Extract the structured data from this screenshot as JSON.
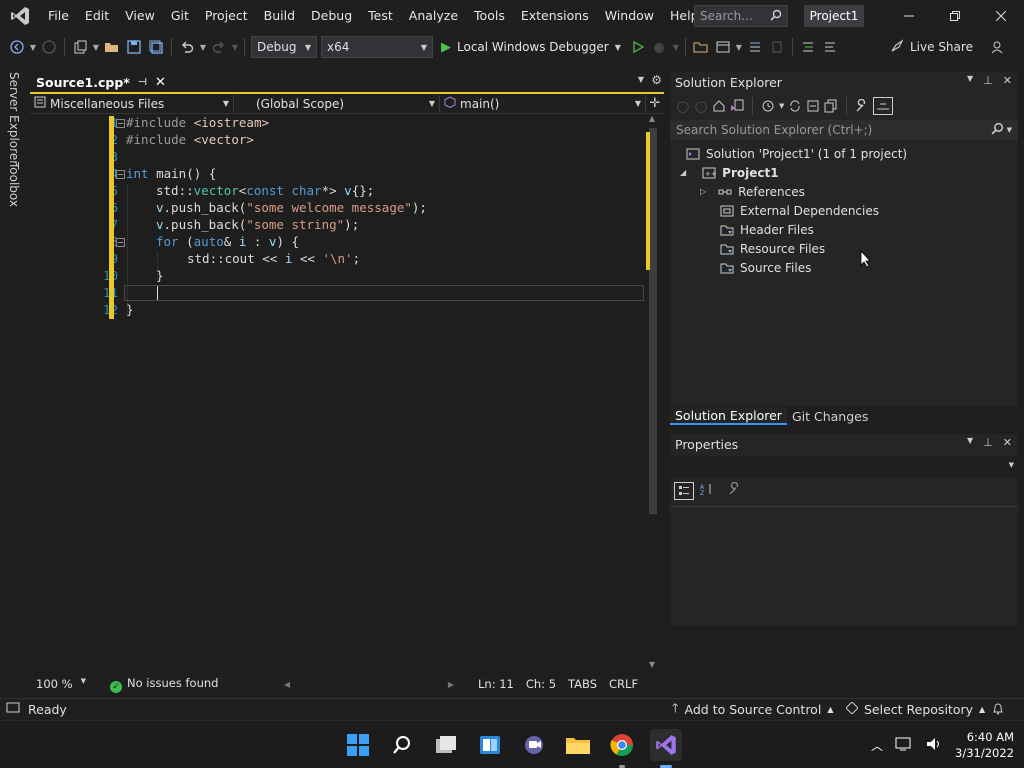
{
  "menubar": {
    "items": [
      "File",
      "Edit",
      "View",
      "Git",
      "Project",
      "Build",
      "Debug",
      "Test",
      "Analyze",
      "Tools",
      "Extensions",
      "Window",
      "Help"
    ],
    "search_placeholder": "Search...",
    "project_name": "Project1"
  },
  "toolbar": {
    "configuration": "Debug",
    "platform": "x64",
    "run_label": "Local Windows Debugger",
    "live_share": "Live Share"
  },
  "left_strip": {
    "server_explorer": "Server Explorer",
    "toolbox": "Toolbox"
  },
  "editor": {
    "tab_title": "Source1.cpp*",
    "nav_project": "Miscellaneous Files",
    "nav_scope": "(Global Scope)",
    "nav_member": "main()",
    "line_numbers": [
      "1",
      "2",
      "3",
      "4",
      "5",
      "6",
      "7",
      "8",
      "9",
      "10",
      "11",
      "12"
    ],
    "code": {
      "l1_pp": "#include",
      "l1_inc": "<iostream>",
      "l2_pp": "#include",
      "l2_inc": "<vector>",
      "l4_kw": "int",
      "l4_rest": " main() {",
      "l5_a": "std::",
      "l5_ty": "vector",
      "l5_b": "<",
      "l5_kw": "const char",
      "l5_c": "*> ",
      "l5_var": "v",
      "l5_d": "{};",
      "l6_var": "v",
      "l6_a": ".push_back(",
      "l6_str": "\"some welcome message\"",
      "l6_b": ");",
      "l7_var": "v",
      "l7_a": ".push_back(",
      "l7_str": "\"some string\"",
      "l7_b": ");",
      "l8_kw": "for",
      "l8_a": " (",
      "l8_kw2": "auto",
      "l8_b": "& ",
      "l8_var": "i",
      "l8_c": " : ",
      "l8_var2": "v",
      "l8_d": ") {",
      "l9_a": "std::cout << ",
      "l9_var": "i",
      "l9_b": " << ",
      "l9_str": "'\\n'",
      "l9_c": ";",
      "l10": "}",
      "l12": "}"
    },
    "status": {
      "zoom": "100 %",
      "issues": "No issues found",
      "line": "Ln: 11",
      "col": "Ch: 5",
      "tabs": "TABS",
      "eol": "CRLF"
    }
  },
  "solution_explorer": {
    "title": "Solution Explorer",
    "search_placeholder": "Search Solution Explorer (Ctrl+;)",
    "solution": "Solution 'Project1' (1 of 1 project)",
    "project": "Project1",
    "items": [
      "References",
      "External Dependencies",
      "Header Files",
      "Resource Files",
      "Source Files"
    ],
    "tabs": [
      "Solution Explorer",
      "Git Changes"
    ]
  },
  "properties": {
    "title": "Properties"
  },
  "statusbar": {
    "ready": "Ready",
    "source_control": "Add to Source Control",
    "repository": "Select Repository"
  },
  "taskbar": {
    "time": "6:40 AM",
    "date": "3/31/2022"
  },
  "colors": {
    "accent": "#e8c82d",
    "keyword": "#569cd6",
    "string": "#d69d85",
    "type": "#4ec9b0",
    "variable": "#9cdcfe",
    "selection_tab": "#3794ff"
  }
}
